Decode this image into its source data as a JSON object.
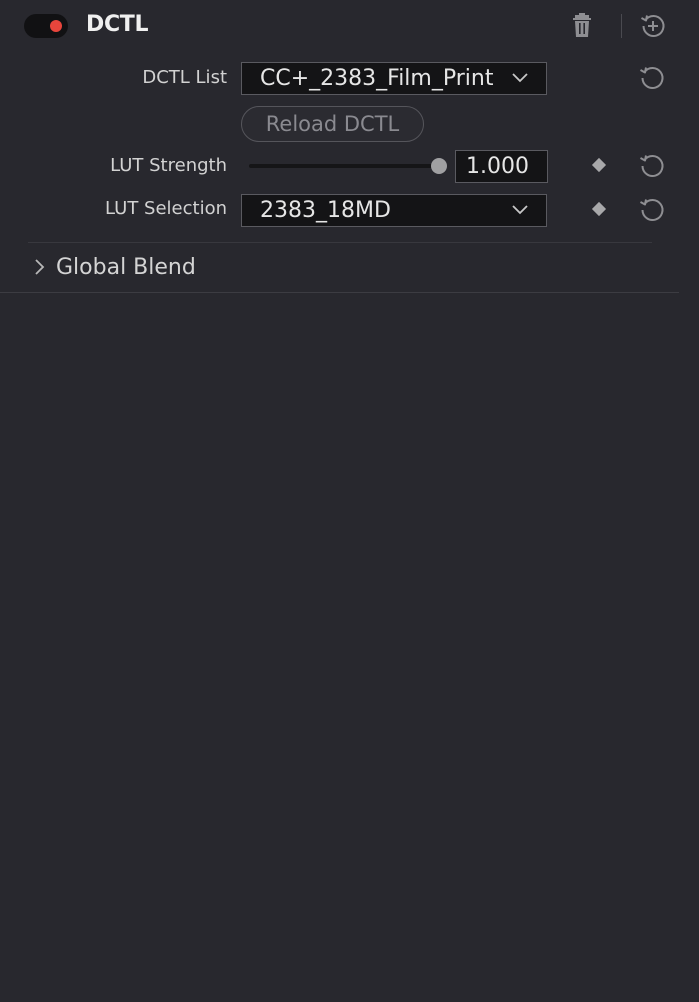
{
  "header": {
    "title": "DCTL",
    "enabled": true,
    "toggle_color": "#e8453c",
    "icons": [
      "trash-icon",
      "add-node-icon"
    ]
  },
  "dctl_list": {
    "label": "DCTL List",
    "value": "CC+_2383_Film_Print"
  },
  "reload_button": {
    "label": "Reload DCTL"
  },
  "lut_strength": {
    "label": "LUT Strength",
    "value": "1.000",
    "slider_fraction": 1.0
  },
  "lut_selection": {
    "label": "LUT Selection",
    "value": "2383_18MD"
  },
  "global_blend": {
    "label": "Global Blend",
    "expanded": false
  }
}
